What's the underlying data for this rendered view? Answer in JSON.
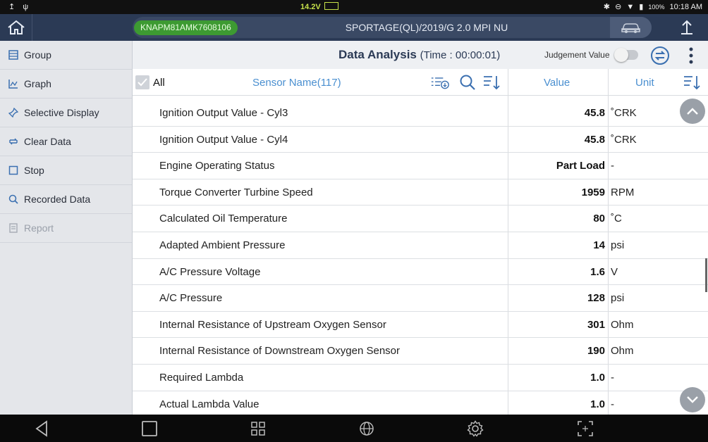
{
  "status_bar": {
    "left_icons": [
      "upload-icon",
      "usb-icon"
    ],
    "voltage": "14.2V",
    "battery_percent": "100%",
    "time": "10:18 AM"
  },
  "header": {
    "vin": "KNAPM81AMK7608106",
    "vehicle": "SPORTAGE(QL)/2019/G 2.0 MPI NU"
  },
  "sidebar": {
    "items": [
      {
        "label": "Group",
        "icon": "group-icon",
        "enabled": true
      },
      {
        "label": "Graph",
        "icon": "graph-icon",
        "enabled": true
      },
      {
        "label": "Selective Display",
        "icon": "pin-icon",
        "enabled": true
      },
      {
        "label": "Clear Data",
        "icon": "refresh-icon",
        "enabled": true
      },
      {
        "label": "Stop",
        "icon": "stop-icon",
        "enabled": true
      },
      {
        "label": "Recorded Data",
        "icon": "search-doc-icon",
        "enabled": true
      },
      {
        "label": "Report",
        "icon": "report-icon",
        "enabled": false
      }
    ]
  },
  "main": {
    "title": "Data Analysis",
    "time": "(Time : 00:00:01)",
    "judgement_label": "Judgement Value",
    "judgement_on": false,
    "columns": {
      "all": "All",
      "sensor": "Sensor Name(117)",
      "value": "Value",
      "unit": "Unit"
    },
    "rows": [
      {
        "name": "Ignition Output Value - Cyl3",
        "value": "45.8",
        "unit": "˚CRK"
      },
      {
        "name": "Ignition Output Value - Cyl4",
        "value": "45.8",
        "unit": "˚CRK"
      },
      {
        "name": "Engine Operating Status",
        "value": "Part Load",
        "unit": "-"
      },
      {
        "name": "Torque Converter Turbine Speed",
        "value": "1959",
        "unit": "RPM"
      },
      {
        "name": "Calculated Oil Temperature",
        "value": "80",
        "unit": "˚C"
      },
      {
        "name": "Adapted Ambient Pressure",
        "value": "14",
        "unit": "psi"
      },
      {
        "name": "A/C Pressure Voltage",
        "value": "1.6",
        "unit": "V"
      },
      {
        "name": "A/C Pressure",
        "value": "128",
        "unit": "psi"
      },
      {
        "name": "Internal Resistance of Upstream Oxygen Sensor",
        "value": "301",
        "unit": "Ohm"
      },
      {
        "name": "Internal Resistance of Downstream Oxygen Sensor",
        "value": "190",
        "unit": "Ohm"
      },
      {
        "name": "Required Lambda",
        "value": "1.0",
        "unit": "-"
      },
      {
        "name": "Actual Lambda Value",
        "value": "1.0",
        "unit": "-"
      }
    ]
  },
  "colors": {
    "header_bg": "#2b3a55",
    "vin_pill": "#3d9a32",
    "accent_blue": "#4a8fd0",
    "sidebar_bg": "#e4e6ea"
  }
}
